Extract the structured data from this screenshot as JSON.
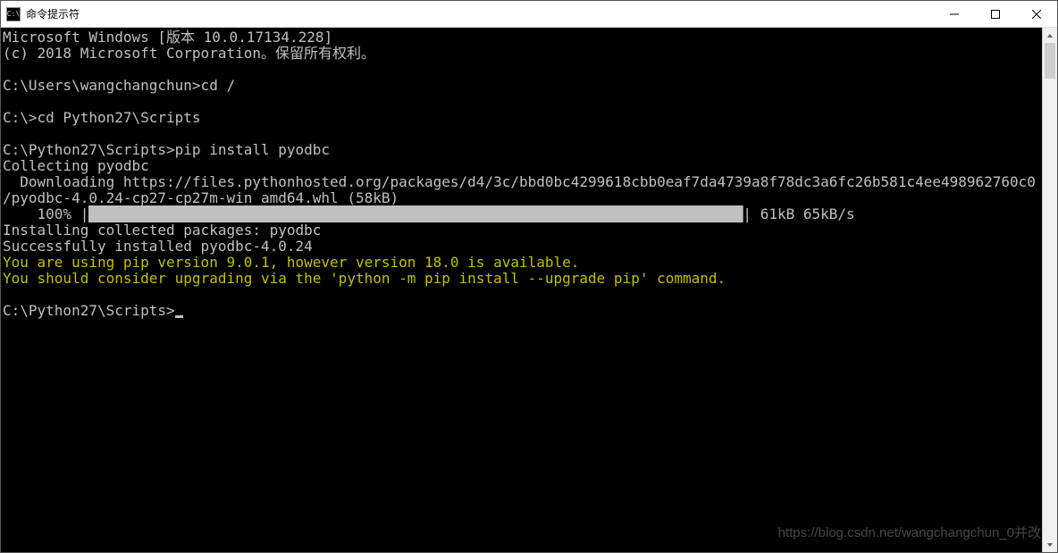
{
  "window": {
    "title": "命令提示符",
    "icon_label": "C:\\"
  },
  "terminal": {
    "line1": "Microsoft Windows [版本 10.0.17134.228]",
    "line2": "(c) 2018 Microsoft Corporation。保留所有权利。",
    "blank": "",
    "prompt1": "C:\\Users\\wangchangchun>cd /",
    "prompt2": "C:\\>cd Python27\\Scripts",
    "prompt3": "C:\\Python27\\Scripts>pip install pyodbc",
    "collecting": "Collecting pyodbc",
    "downloading": "  Downloading https://files.pythonhosted.org/packages/d4/3c/bbd0bc4299618cbb0eaf7da4739a8f78dc3a6fc26b581c4ee498962760c0",
    "whl": "/pyodbc-4.0.24-cp27-cp27m-win_amd64.whl (58kB)",
    "progress_prefix": "    100% |",
    "progress_bar": "████████████████████████████████████████████████████████████████████████████",
    "progress_suffix": "| 61kB 65kB/s",
    "installing": "Installing collected packages: pyodbc",
    "success": "Successfully installed pyodbc-4.0.24",
    "warn1": "You are using pip version 9.0.1, however version 18.0 is available.",
    "warn2": "You should consider upgrading via the 'python -m pip install --upgrade pip' command.",
    "prompt4": "C:\\Python27\\Scripts>"
  },
  "watermark": "https://blog.csdn.net/wangchangchun_0并改"
}
